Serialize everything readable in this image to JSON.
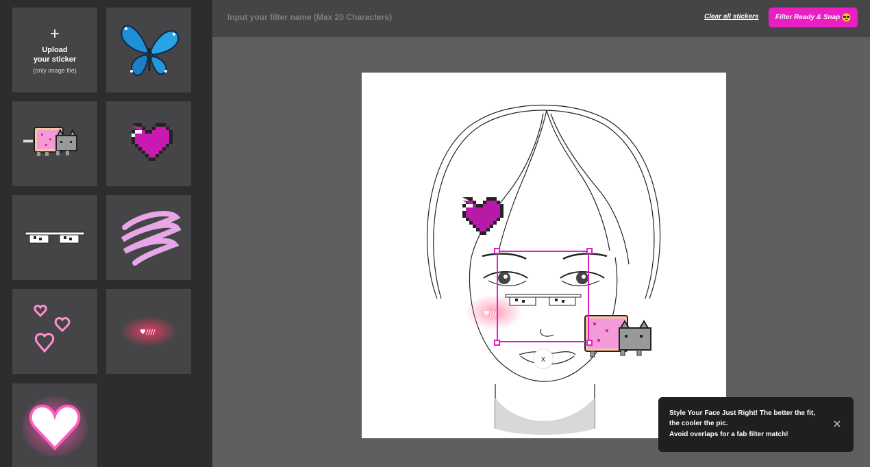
{
  "sidebar": {
    "upload": {
      "plus": "+",
      "title_line1": "Upload",
      "title_line2": "your sticker",
      "subtitle": "(only image file)"
    },
    "stickers": [
      {
        "name": "butterfly-sticker"
      },
      {
        "name": "nyan-cat-sticker"
      },
      {
        "name": "pixel-heart-sticker"
      },
      {
        "name": "pixel-sunglasses-sticker"
      },
      {
        "name": "pink-scribble-sticker"
      },
      {
        "name": "pink-hearts-sticker"
      },
      {
        "name": "blush-sticker"
      },
      {
        "name": "glowing-heart-sticker"
      }
    ]
  },
  "header": {
    "filter_name_placeholder": "Input your filter name (Max 20 Characters)",
    "filter_name_value": "",
    "clear_label": "Clear all stickers",
    "snap_label": "Filter Ready & Snap"
  },
  "canvas": {
    "delete_label": "x"
  },
  "toast": {
    "line1": "Style Your Face Just Right! The better the fit,",
    "line2": "the cooler the pic.",
    "line3": "Avoid overlaps for a fab filter match!"
  },
  "colors": {
    "accent": "#e91ec3",
    "sidebar_bg": "#2d2d2f",
    "tile_bg": "#454547",
    "workspace_bg": "#5f5f61",
    "toast_bg": "#1f1f21"
  },
  "icons": [
    "plus-icon",
    "sunglasses-emoji-icon",
    "close-icon"
  ]
}
